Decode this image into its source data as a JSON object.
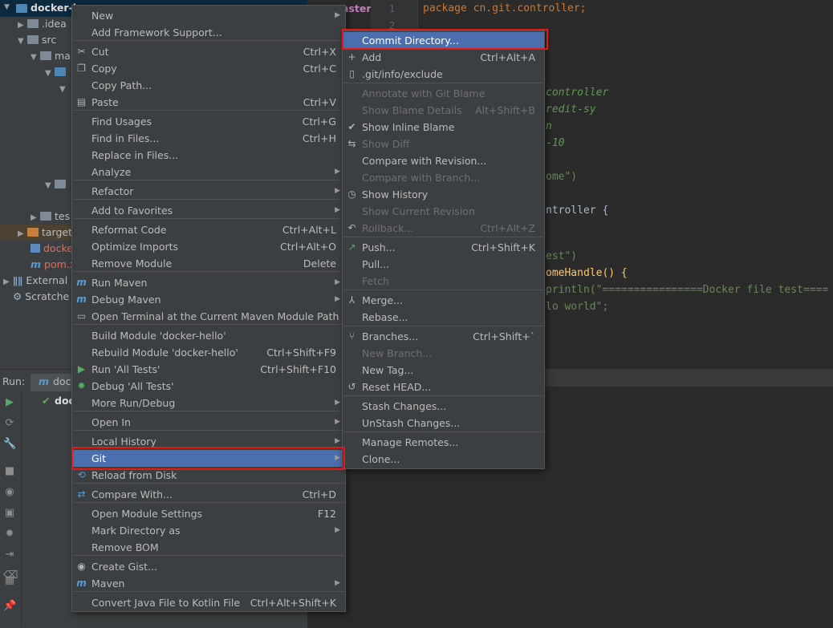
{
  "project": {
    "root": "docker-h",
    "branch_fragment": "aster/",
    "items": [
      {
        "label": ".idea"
      },
      {
        "label": "src"
      },
      {
        "label": "ma"
      },
      {
        "label": "tes"
      },
      {
        "label": "target"
      },
      {
        "label": "docke"
      },
      {
        "label": "pom.x"
      },
      {
        "label": "External"
      },
      {
        "label": "Scratche"
      }
    ]
  },
  "run": {
    "label": "Run:",
    "tab": "doc",
    "node": "doc"
  },
  "editor": {
    "line_numbers": [
      "1",
      "2"
    ],
    "lines": [
      "package cn.git.controller;",
      "controller",
      "redit-sy",
      "n",
      "-10",
      "ome\")",
      "ntroller {",
      "est\")",
      "omeHandle() {",
      "println(\"================Docker file test====",
      "lo world\";"
    ]
  },
  "context_menu": {
    "items": [
      {
        "label": "New",
        "submenu": true
      },
      {
        "label": "Add Framework Support..."
      },
      {
        "label": "Cut",
        "shortcut": "Ctrl+X",
        "icon": "scissors-icon"
      },
      {
        "label": "Copy",
        "shortcut": "Ctrl+C",
        "icon": "copy-icon"
      },
      {
        "label": "Copy Path..."
      },
      {
        "label": "Paste",
        "shortcut": "Ctrl+V",
        "icon": "paste-icon"
      },
      {
        "label": "Find Usages",
        "shortcut": "Ctrl+G"
      },
      {
        "label": "Find in Files...",
        "shortcut": "Ctrl+H"
      },
      {
        "label": "Replace in Files..."
      },
      {
        "label": "Analyze",
        "submenu": true
      },
      {
        "label": "Refactor",
        "submenu": true
      },
      {
        "label": "Add to Favorites",
        "submenu": true
      },
      {
        "label": "Reformat Code",
        "shortcut": "Ctrl+Alt+L"
      },
      {
        "label": "Optimize Imports",
        "shortcut": "Ctrl+Alt+O"
      },
      {
        "label": "Remove Module",
        "shortcut": "Delete"
      },
      {
        "label": "Run Maven",
        "submenu": true,
        "icon": "maven-run-icon"
      },
      {
        "label": "Debug Maven",
        "submenu": true,
        "icon": "maven-debug-icon"
      },
      {
        "label": "Open Terminal at the Current Maven Module Path",
        "icon": "terminal-icon"
      },
      {
        "label": "Build Module 'docker-hello'"
      },
      {
        "label": "Rebuild Module 'docker-hello'",
        "shortcut": "Ctrl+Shift+F9"
      },
      {
        "label": "Run 'All Tests'",
        "shortcut": "Ctrl+Shift+F10",
        "icon": "run-icon"
      },
      {
        "label": "Debug 'All Tests'",
        "icon": "debug-icon"
      },
      {
        "label": "More Run/Debug",
        "submenu": true
      },
      {
        "label": "Open In",
        "submenu": true
      },
      {
        "label": "Local History",
        "submenu": true
      },
      {
        "label": "Git",
        "submenu": true,
        "selected": true
      },
      {
        "label": "Reload from Disk",
        "icon": "reload-icon"
      },
      {
        "label": "Compare With...",
        "shortcut": "Ctrl+D",
        "icon": "compare-icon"
      },
      {
        "label": "Open Module Settings",
        "shortcut": "F12"
      },
      {
        "label": "Mark Directory as",
        "submenu": true
      },
      {
        "label": "Remove BOM"
      },
      {
        "label": "Create Gist...",
        "icon": "github-icon"
      },
      {
        "label": "Maven",
        "submenu": true,
        "icon": "maven-icon"
      },
      {
        "label": "Convert Java File to Kotlin File",
        "shortcut": "Ctrl+Alt+Shift+K"
      }
    ]
  },
  "git_menu": {
    "items": [
      {
        "label": "Commit Directory...",
        "selected": true
      },
      {
        "label": "Add",
        "shortcut": "Ctrl+Alt+A",
        "icon": "plus-icon"
      },
      {
        "label": ".git/info/exclude",
        "icon": "git-file-icon"
      },
      {
        "label": "Annotate with Git Blame",
        "disabled": true
      },
      {
        "label": "Show Blame Details",
        "shortcut": "Alt+Shift+B",
        "disabled": true
      },
      {
        "label": "Show Inline Blame",
        "icon": "checkmark-icon"
      },
      {
        "label": "Show Diff",
        "disabled": true,
        "icon": "diff-icon"
      },
      {
        "label": "Compare with Revision..."
      },
      {
        "label": "Compare with Branch...",
        "disabled": true
      },
      {
        "label": "Show History",
        "icon": "history-icon"
      },
      {
        "label": "Show Current Revision",
        "disabled": true
      },
      {
        "label": "Rollback...",
        "shortcut": "Ctrl+Alt+Z",
        "disabled": true,
        "icon": "rollback-icon"
      },
      {
        "label": "Push...",
        "shortcut": "Ctrl+Shift+K",
        "icon": "push-icon"
      },
      {
        "label": "Pull..."
      },
      {
        "label": "Fetch",
        "disabled": true
      },
      {
        "label": "Merge...",
        "icon": "merge-icon"
      },
      {
        "label": "Rebase..."
      },
      {
        "label": "Branches...",
        "shortcut": "Ctrl+Shift+`",
        "icon": "branch-icon"
      },
      {
        "label": "New Branch...",
        "disabled": true
      },
      {
        "label": "New Tag..."
      },
      {
        "label": "Reset HEAD...",
        "icon": "reset-icon"
      },
      {
        "label": "Stash Changes..."
      },
      {
        "label": "UnStash Changes..."
      },
      {
        "label": "Manage Remotes..."
      },
      {
        "label": "Clone..."
      }
    ]
  },
  "colors": {
    "menu_bg": "#3c3f41",
    "selection": "#4b6eaf",
    "highlight_box": "#e11919"
  }
}
